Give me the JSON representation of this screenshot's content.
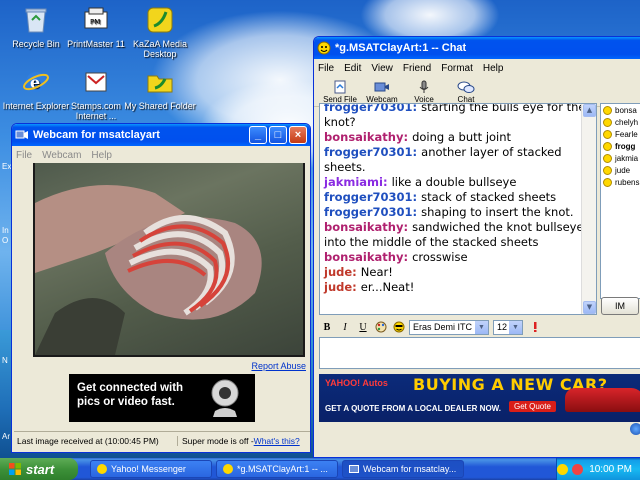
{
  "desktop_icons": [
    {
      "label": "Recycle Bin",
      "icon": "recycle-bin-icon"
    },
    {
      "label": "PrintMaster 11",
      "icon": "printmaster-icon"
    },
    {
      "label": "KaZaA Media Desktop",
      "icon": "kazaa-icon"
    },
    {
      "label": "Internet Explorer",
      "icon": "internet-explorer-icon"
    },
    {
      "label": "Stamps.com Internet ...",
      "icon": "stamps-icon"
    },
    {
      "label": "My Shared Folder",
      "icon": "shared-folder-icon"
    }
  ],
  "chat_window": {
    "title": "*g.MSATClayArt:1 -- Chat",
    "menu": [
      "File",
      "Edit",
      "View",
      "Friend",
      "Format",
      "Help"
    ],
    "toolbar": [
      "Send File",
      "Webcam",
      "Voice",
      "Chat"
    ],
    "messages": [
      {
        "nick": "frogger70301",
        "text": "starting the bulls eye for the",
        "cont": "knot?",
        "color": "#1f4fbf"
      },
      {
        "nick": "bonsaikathy",
        "text": "doing a butt joint",
        "cont": "",
        "color": "#b0216f"
      },
      {
        "nick": "frogger70301",
        "text": "another layer of stacked",
        "cont": "sheets.",
        "color": "#1f4fbf"
      },
      {
        "nick": "jakmiami",
        "text": "like a double bullseye",
        "cont": "",
        "color": "#8a2be2"
      },
      {
        "nick": "frogger70301",
        "text": "stack of stacked sheets",
        "cont": "",
        "color": "#1f4fbf"
      },
      {
        "nick": "frogger70301",
        "text": "shaping to insert the knot.",
        "cont": "",
        "color": "#1f4fbf"
      },
      {
        "nick": "bonsaikathy",
        "text": "sandwiched the knot bullseye",
        "cont": "into the middle of the stacked sheets",
        "color": "#b0216f"
      },
      {
        "nick": "bonsaikathy",
        "text": "crosswise",
        "cont": "",
        "color": "#b0216f"
      },
      {
        "nick": "jude",
        "text": "Near!",
        "cont": "",
        "color": "#c0392b"
      },
      {
        "nick": "jude",
        "text": "er...Neat!",
        "cont": "",
        "color": "#c0392b"
      }
    ],
    "users": [
      "bonsa",
      "chelyh",
      "Fearle",
      "frogg",
      "jakmia",
      "jude",
      "rubens"
    ],
    "im_label": "IM",
    "font_name": "Eras Demi ITC",
    "font_size": "12",
    "ad": {
      "brand": "YAHOO! Autos",
      "headline": "BUYING A NEW CAR?",
      "sub": "GET A QUOTE FROM A LOCAL DEALER NOW.",
      "button": "Get Quote"
    }
  },
  "webcam_window": {
    "title": "Webcam for msatclayart",
    "menu": [
      "File",
      "Webcam",
      "Help"
    ],
    "report_abuse": "Report Abuse",
    "ad_text": "Get connected with pics or video fast.",
    "status_left": "Last image received at (10:00:45 PM)",
    "status_super": "Super mode is off - ",
    "status_link": "What's this?"
  },
  "taskbar": {
    "start": "start",
    "tasks": [
      "Yahoo! Messenger",
      "*g.MSATClayArt:1 -- ...",
      "Webcam for msatclay..."
    ],
    "clock": "10:00 PM"
  },
  "left_edge_text": [
    "Ex",
    "In",
    "O",
    "N",
    "Ar"
  ]
}
